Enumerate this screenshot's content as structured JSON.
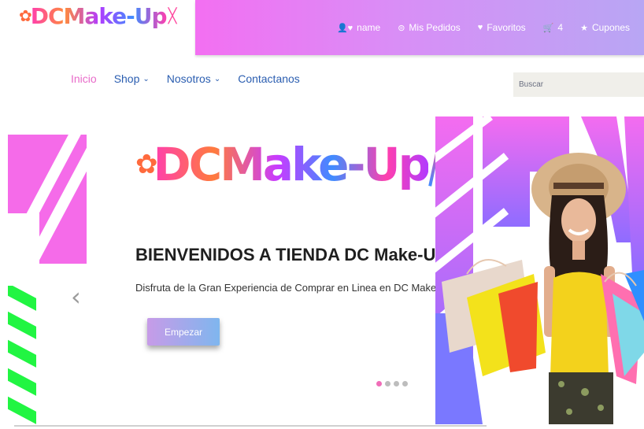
{
  "brand": {
    "logo_text": "DCMake-Up"
  },
  "topbar": {
    "user": "name",
    "orders": "Mis Pedidos",
    "favorites": "Favoritos",
    "cart_count": "4",
    "coupons": "Cupones"
  },
  "nav": {
    "home": "Inicio",
    "shop": "Shop",
    "about": "Nosotros",
    "contact": "Contactanos"
  },
  "search": {
    "placeholder": "Buscar"
  },
  "hero": {
    "logo_text": "DCMake-Up",
    "title": "BIENVENIDOS A TIENDA DC Make-Up",
    "subtitle": "Disfruta de la Gran Experiencia de Comprar en Linea en DC Make-Up.",
    "button": "Empezar",
    "prev_arrow": "‹",
    "slides": 4,
    "active_slide": 1
  },
  "colors": {
    "topbar_start": "#f36ff2",
    "topbar_end": "#b8a6f4",
    "nav_link": "#2a5db0",
    "nav_active": "#e86bc9",
    "dot_active": "#f06db8"
  }
}
